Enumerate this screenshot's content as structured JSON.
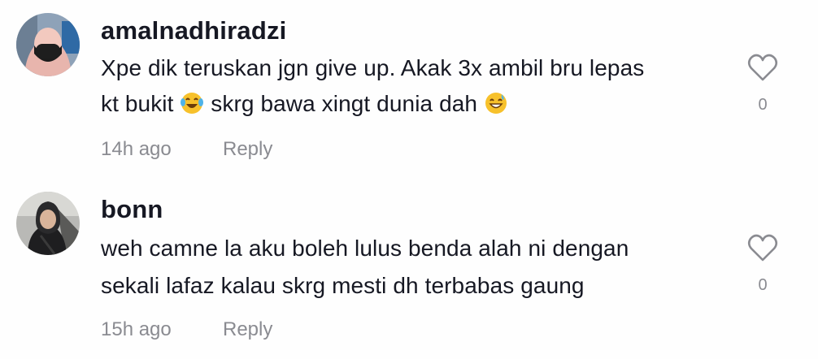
{
  "comments": [
    {
      "username": "amalnadhiradzi",
      "text_line1": "Xpe dik teruskan jgn give up. Akak 3x ambil bru lepas",
      "text_line2_a": "kt bukit ",
      "text_line2_b": " skrg bawa xingt dunia dah ",
      "emoji_1": "face-with-tears-of-joy-icon",
      "emoji_2": "grinning-face-with-sweat-icon",
      "time": "14h ago",
      "reply_label": "Reply",
      "like_count": "0"
    },
    {
      "username": "bonn",
      "text_line1": "weh camne la aku boleh lulus benda alah ni dengan",
      "text_line2": "sekali lafaz kalau skrg mesti dh terbabas gaung",
      "time": "15h ago",
      "reply_label": "Reply",
      "like_count": "0"
    }
  ],
  "colors": {
    "text": "#161823",
    "muted": "#8a8b91",
    "background": "#fefefe"
  }
}
